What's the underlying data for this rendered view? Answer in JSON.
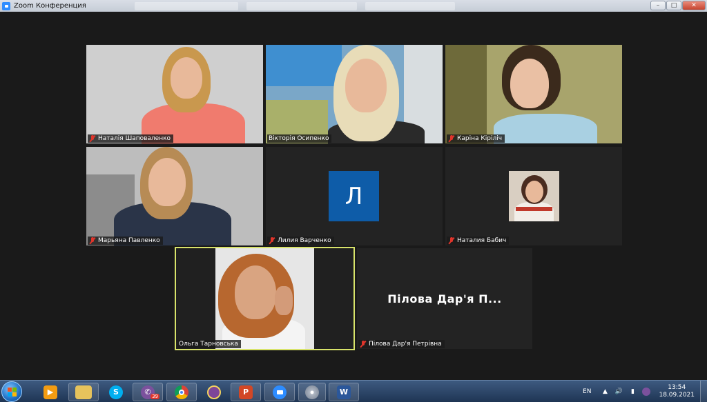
{
  "window": {
    "title": "Zoom Конференция",
    "controls": {
      "minimize": "–",
      "maximize": "□",
      "close": "✕"
    }
  },
  "participants": [
    {
      "name": "Наталія Шаповаленко",
      "muted": true
    },
    {
      "name": "Вікторія Осипенко",
      "muted": false
    },
    {
      "name": "Каріна Кіріліч",
      "muted": true
    },
    {
      "name": "Марьяна Павленко",
      "muted": true
    },
    {
      "name": "Лилия Варченко",
      "muted": true,
      "avatar_letter": "Л",
      "avatar_color": "#0e5ca8"
    },
    {
      "name": "Наталия Бабич",
      "muted": true
    },
    {
      "name": "Ольга Тарновська",
      "muted": false,
      "active_speaker": true
    },
    {
      "name": "Пілова Дар'я Петрівна",
      "muted": true,
      "display_name_large": "Пілова Дар'я П..."
    }
  ],
  "colors": {
    "active_speaker_border": "#d8e36a",
    "mute_red": "#e0352b",
    "background": "#1a1a1a"
  },
  "taskbar": {
    "items": [
      {
        "icon": "media-player-icon"
      },
      {
        "icon": "file-explorer-icon"
      },
      {
        "icon": "skype-icon",
        "glyph": "S"
      },
      {
        "icon": "viber-icon",
        "badge": "39"
      },
      {
        "icon": "chrome-icon"
      },
      {
        "icon": "tor-browser-icon"
      },
      {
        "icon": "powerpoint-icon",
        "glyph": "P"
      },
      {
        "icon": "zoom-icon"
      },
      {
        "icon": "disc-icon"
      },
      {
        "icon": "word-icon",
        "glyph": "W"
      }
    ],
    "tray": {
      "language": "EN",
      "time": "13:54",
      "date": "18.09.2021"
    }
  }
}
